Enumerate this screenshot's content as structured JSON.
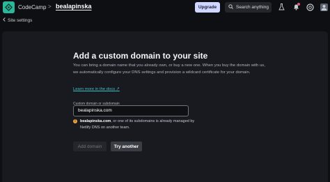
{
  "topbar": {
    "brand": "CodeCamp",
    "separator": ">",
    "site_name": "bealapinska",
    "upgrade_label": "Upgrade",
    "search_label": "Search anything",
    "icons": [
      "logo-icon",
      "search-icon",
      "lab-icon",
      "bell-icon",
      "help-icon",
      "avatar"
    ]
  },
  "nav": {
    "back_label": "Site settings"
  },
  "main": {
    "title": "Add a custom domain to your site",
    "description": "You can bring a domain name that you already own, or buy a new one. When you buy the domain with us, we automatically configure your DNS settings and provision a wildcard certificate for your domain.",
    "learn_more": "Learn more in the docs",
    "field_label": "Custom domain or subdomain",
    "field_value": "bealapinska.com",
    "warning_domain": "bealapinska.com",
    "warning_text": ", or one of its subdomains is already managed by Netlify DNS on another team.",
    "add_button": "Add domain",
    "try_button": "Try another"
  },
  "colors": {
    "background": "#0e0f12",
    "panel": "#181a1f",
    "upgrade": "#cfd6ff",
    "link": "#39c3c7",
    "warning": "#f0a23b",
    "notification": "#e0577a"
  }
}
